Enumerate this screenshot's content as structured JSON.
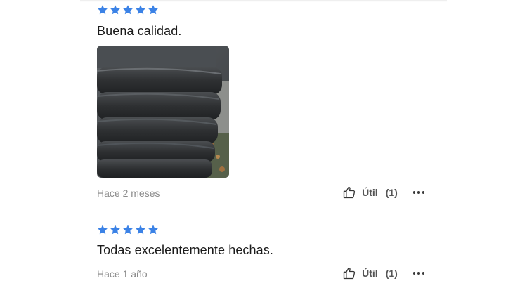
{
  "colors": {
    "star": "#3b82e6",
    "divider": "#e4e4e4",
    "meta": "#8a8a8a"
  },
  "reviews": [
    {
      "rating": 5,
      "text": "Buena calidad.",
      "has_photo": true,
      "photo_icon": "stacked-rubber-rings-photo",
      "date": "Hace 2 meses",
      "helpful_label": "Útil",
      "helpful_count": "(1)"
    },
    {
      "rating": 5,
      "text": "Todas excelentemente hechas.",
      "has_photo": false,
      "date": "Hace 1 año",
      "helpful_label": "Útil",
      "helpful_count": "(1)"
    }
  ],
  "icons": {
    "star": "star-icon",
    "like": "thumbs-up-icon",
    "more": "more-options-icon"
  }
}
